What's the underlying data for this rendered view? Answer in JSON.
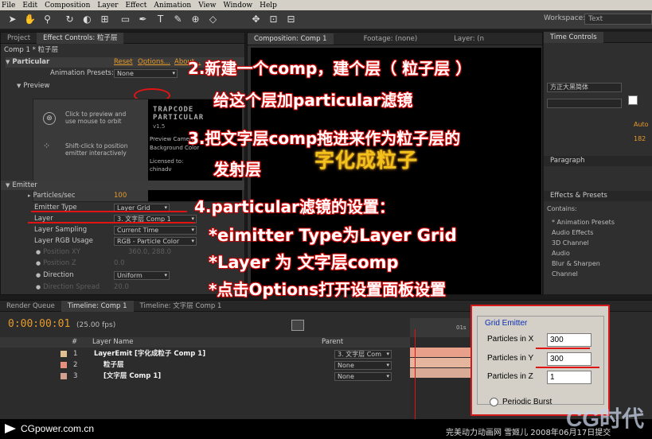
{
  "menu": [
    "File",
    "Edit",
    "Composition",
    "Layer",
    "Effect",
    "Animation",
    "View",
    "Window",
    "Help"
  ],
  "workspace": {
    "label": "Workspace:",
    "value": "Text"
  },
  "left_panel": {
    "tabs": [
      "Project",
      "Effect Controls: 粒子层"
    ],
    "header": "Comp 1 * 粒子层",
    "effect_name": "Particular",
    "links": [
      "Reset",
      "Options...",
      "About..."
    ],
    "animation_presets": {
      "label": "Animation Presets:",
      "value": "None"
    },
    "preview": {
      "label": "Preview",
      "click_text": "Click to preview and\nuse mouse to orbit",
      "shift_text": "Shift-click to position\nemitter interactively",
      "brand": "TRAPCODE\nPARTICULAR",
      "version": "v1.5",
      "preview_camera": "Preview Camera",
      "background_color": "Background Color",
      "licensed": "Licensed to:",
      "licensee": "chinadv"
    },
    "emitter": {
      "label": "Emitter",
      "particles_sec_label": "Particles/sec",
      "particles_sec": "100",
      "type_label": "Emitter Type",
      "type": "Layer Grid",
      "layer_label": "Layer",
      "layer": "3. 文字层 Comp 1",
      "sampling_label": "Layer Sampling",
      "sampling": "Current Time",
      "rgb_label": "Layer RGB Usage",
      "rgb": "RGB - Particle Color",
      "position_label": "Position XY",
      "position": "360.0, 288.0",
      "position_z_label": "Position Z",
      "position_z": "0.0",
      "direction_label": "Direction",
      "direction": "Uniform",
      "direction_spread_label": "Direction Spread",
      "direction_spread": "20.0"
    }
  },
  "comp_panel": {
    "tabs": [
      "Composition: Comp 1",
      "Footage: (none)",
      "Layer: (n"
    ],
    "glow_text": "字化成粒子"
  },
  "right_panel": {
    "time_controls": "Time Controls",
    "font": "方正大黑简体",
    "auto_label": "Auto",
    "size": "182",
    "paragraph": "Paragraph",
    "effects_presets": "Effects & Presets",
    "contains": "Contains:",
    "items": [
      "* Animation Presets",
      "Audio Effects",
      "3D Channel",
      "Audio",
      "Blur & Sharpen",
      "Channel"
    ]
  },
  "annotations": {
    "l1": "2.新建一个comp，建个层（ 粒子层 ）",
    "l2": "给这个层加particular滤镜",
    "l3": "3.把文字层comp拖进来作为粒子层的",
    "l4": "发射层",
    "l5": "4.particular滤镜的设置：",
    "l6": "*eimitter Type为Layer Grid",
    "l7": "*Layer 为 文字层comp",
    "l8": "*点击Options打开设置面板设置"
  },
  "timeline": {
    "tabs": [
      "Render Queue",
      "Timeline: Comp 1",
      "Timeline: 文字层 Comp 1"
    ],
    "timecode": "0:00:00:01",
    "fps": "(25.00 fps)",
    "col_num": "#",
    "col_layer": "Layer Name",
    "col_parent": "Parent",
    "ruler_label": "01s",
    "layers": [
      {
        "num": "1",
        "name": "LayerEmit [字化成粒子 Comp 1]",
        "parent": "3. 文字层 Com",
        "color": "#e0c090"
      },
      {
        "num": "2",
        "name": "粒子层",
        "parent": "None",
        "color": "#e89080"
      },
      {
        "num": "3",
        "name": "[文字层 Comp 1]",
        "parent": "None",
        "color": "#d4a090"
      }
    ]
  },
  "grid_emitter": {
    "title": "Grid Emitter",
    "px_label": "Particles in X",
    "px": "300",
    "py_label": "Particles in Y",
    "py": "300",
    "pz_label": "Particles in Z",
    "pz": "1",
    "burst": "Periodic Burst"
  },
  "footer": {
    "site": "CGpower.com.cn",
    "credit": "完美动力动画网 雪姬儿 2008年06月17日提交",
    "logo": "CG时代"
  }
}
